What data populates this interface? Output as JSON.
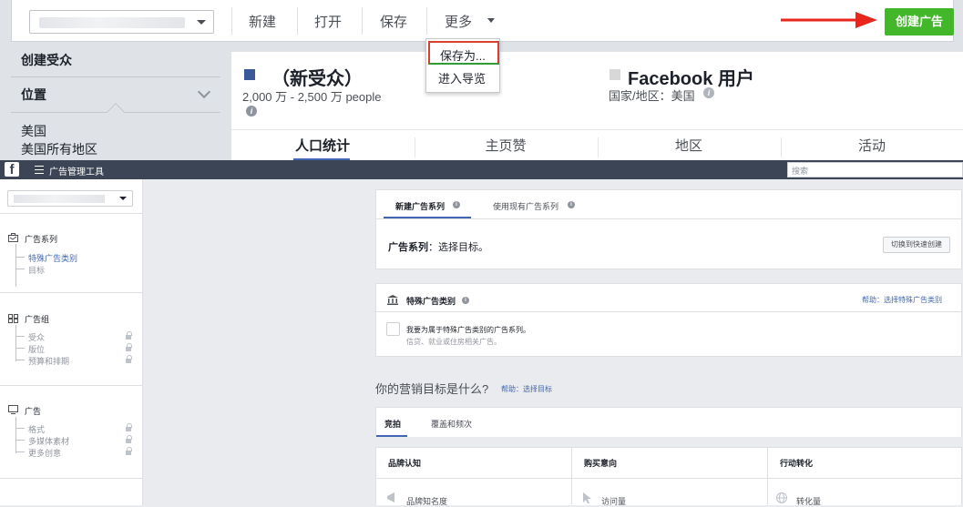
{
  "insights": {
    "toolbar": {
      "new_label": "新建",
      "open_label": "打开",
      "save_label": "保存",
      "more_label": "更多",
      "create_ad_label": "创建广告"
    },
    "more_menu": {
      "items": [
        "保存为...",
        "进入导览"
      ]
    },
    "left_panel": {
      "create_audience": "创建受众",
      "location_label": "位置",
      "location_country": "美国",
      "location_detail": "美国所有地区"
    },
    "summary": {
      "audience_name": "（新受众）",
      "audience_size": "2,000 万 - 2,500 万 people",
      "comparison_title": "Facebook 用户",
      "country_label": "国家/地区：",
      "country_value": "美国",
      "colors": {
        "audience": "#3b5998",
        "comparison": "#d8d8d8"
      }
    },
    "tabs": [
      "人口统计",
      "主页赞",
      "地区",
      "活动"
    ]
  },
  "ads_manager": {
    "nav": {
      "logo": "f",
      "title": "广告管理工具",
      "search_placeholder": "搜索"
    },
    "sidebar": {
      "campaign": {
        "title": "广告系列",
        "items": [
          "特殊广告类别",
          "目标"
        ]
      },
      "adset": {
        "title": "广告组",
        "items": [
          "受众",
          "版位",
          "预算和排期"
        ]
      },
      "ad": {
        "title": "广告",
        "items": [
          "格式",
          "多媒体素材",
          "更多创意"
        ]
      }
    },
    "campaign_card": {
      "tabs": [
        "新建广告系列",
        "使用现有广告系列"
      ],
      "label": "广告系列",
      "prompt": "：选择目标。",
      "quick_create": "切换到快速创建"
    },
    "special_card": {
      "title": "特殊广告类别",
      "help_link": "帮助：选择特殊广告类别",
      "checkbox_label": "我要为属于特殊广告类别的广告系列。",
      "checkbox_sub": "信贷、就业或住房相关广告。"
    },
    "objective": {
      "heading": "你的营销目标是什么?",
      "help_link": "帮助：选择目标",
      "tabs": [
        "竞拍",
        "覆盖和频次"
      ],
      "columns": [
        "品牌认知",
        "购买意向",
        "行动转化"
      ],
      "first_row": [
        "品牌知名度",
        "访问量",
        "转化量"
      ]
    }
  }
}
